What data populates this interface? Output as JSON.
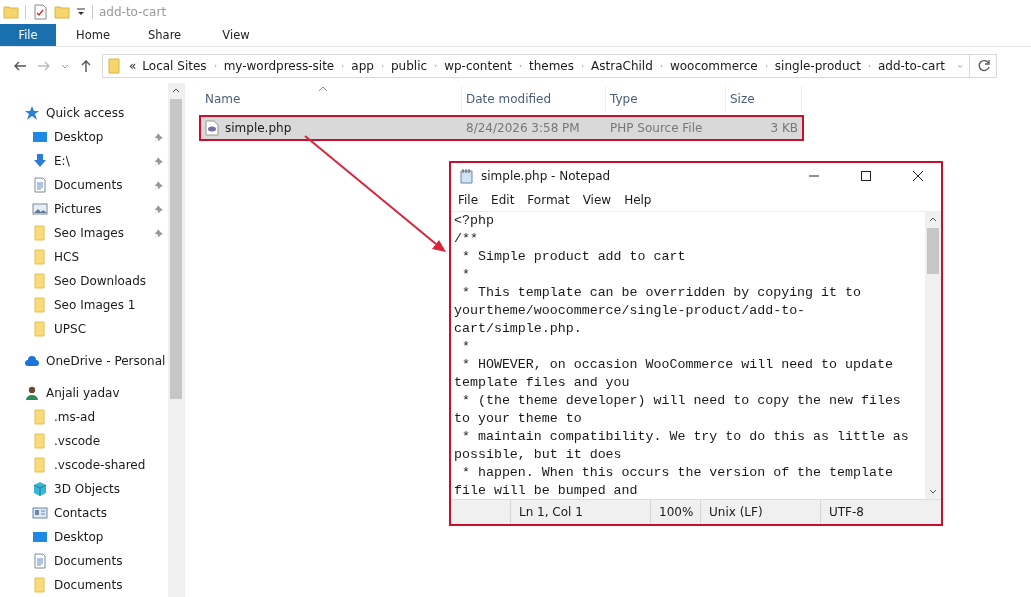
{
  "title_bar": {
    "title": "add-to-cart"
  },
  "ribbon_tabs": [
    {
      "label": "File",
      "selected": true
    },
    {
      "label": "Home",
      "selected": false
    },
    {
      "label": "Share",
      "selected": false
    },
    {
      "label": "View",
      "selected": false
    }
  ],
  "address_bar": {
    "prefix": "«",
    "crumbs": [
      "Local Sites",
      "my-wordpress-site",
      "app",
      "public",
      "wp-content",
      "themes",
      "AstraChild",
      "woocommerce",
      "single-product",
      "add-to-cart"
    ]
  },
  "sidebar": {
    "items": [
      {
        "label": "Quick access",
        "kind": "star",
        "children": [
          {
            "label": "Desktop",
            "kind": "desktop",
            "pinned": true
          },
          {
            "label": "E:\\",
            "kind": "download",
            "pinned": true
          },
          {
            "label": "Documents",
            "kind": "document",
            "pinned": true
          },
          {
            "label": "Pictures",
            "kind": "pictures",
            "pinned": true
          },
          {
            "label": "Seo Images",
            "kind": "folder",
            "pinned": true
          },
          {
            "label": "HCS",
            "kind": "folder",
            "pinned": false
          },
          {
            "label": "Seo Downloads",
            "kind": "folder",
            "pinned": false
          },
          {
            "label": "Seo Images 1",
            "kind": "folder",
            "pinned": false
          },
          {
            "label": "UPSC",
            "kind": "folder",
            "pinned": false
          }
        ]
      },
      {
        "label": "OneDrive - Personal",
        "kind": "cloud"
      },
      {
        "label": "Anjali yadav",
        "kind": "person",
        "children": [
          {
            "label": ".ms-ad",
            "kind": "folder",
            "pinned": false
          },
          {
            "label": ".vscode",
            "kind": "folder",
            "pinned": false
          },
          {
            "label": ".vscode-shared",
            "kind": "folder",
            "pinned": false
          },
          {
            "label": "3D Objects",
            "kind": "cube",
            "pinned": false
          },
          {
            "label": "Contacts",
            "kind": "contacts",
            "pinned": false
          },
          {
            "label": "Desktop",
            "kind": "desktop",
            "pinned": false
          },
          {
            "label": "Documents",
            "kind": "document",
            "pinned": false
          },
          {
            "label": "Documents",
            "kind": "folder",
            "pinned": false
          }
        ]
      }
    ]
  },
  "file_list": {
    "columns": [
      {
        "label": "Name",
        "sorted": true
      },
      {
        "label": "Date modified",
        "sorted": false
      },
      {
        "label": "Type",
        "sorted": false
      },
      {
        "label": "Size",
        "sorted": false
      }
    ],
    "rows": [
      {
        "name": "simple.php",
        "date_modified": "8/24/2026 3:58 PM",
        "type": "PHP Source File",
        "size": "3 KB",
        "selected": true
      }
    ]
  },
  "notepad": {
    "title": "simple.php - Notepad",
    "menu": [
      "File",
      "Edit",
      "Format",
      "View",
      "Help"
    ],
    "lines": [
      "<?php",
      "/**",
      " * Simple product add to cart",
      " *",
      " * This template can be overridden by copying it to",
      "yourtheme/woocommerce/single-product/add-to-",
      "cart/simple.php.",
      " *",
      " * HOWEVER, on occasion WooCommerce will need to update",
      "template files and you",
      " * (the theme developer) will need to copy the new files",
      "to your theme to",
      " * maintain compatibility. We try to do this as little as",
      "possible, but it does",
      " * happen. When this occurs the version of the template",
      "file will be bumped and"
    ],
    "status": {
      "position": "Ln 1, Col 1",
      "zoom": "100%",
      "line_ending": "Unix (LF)",
      "encoding": "UTF-8"
    }
  }
}
